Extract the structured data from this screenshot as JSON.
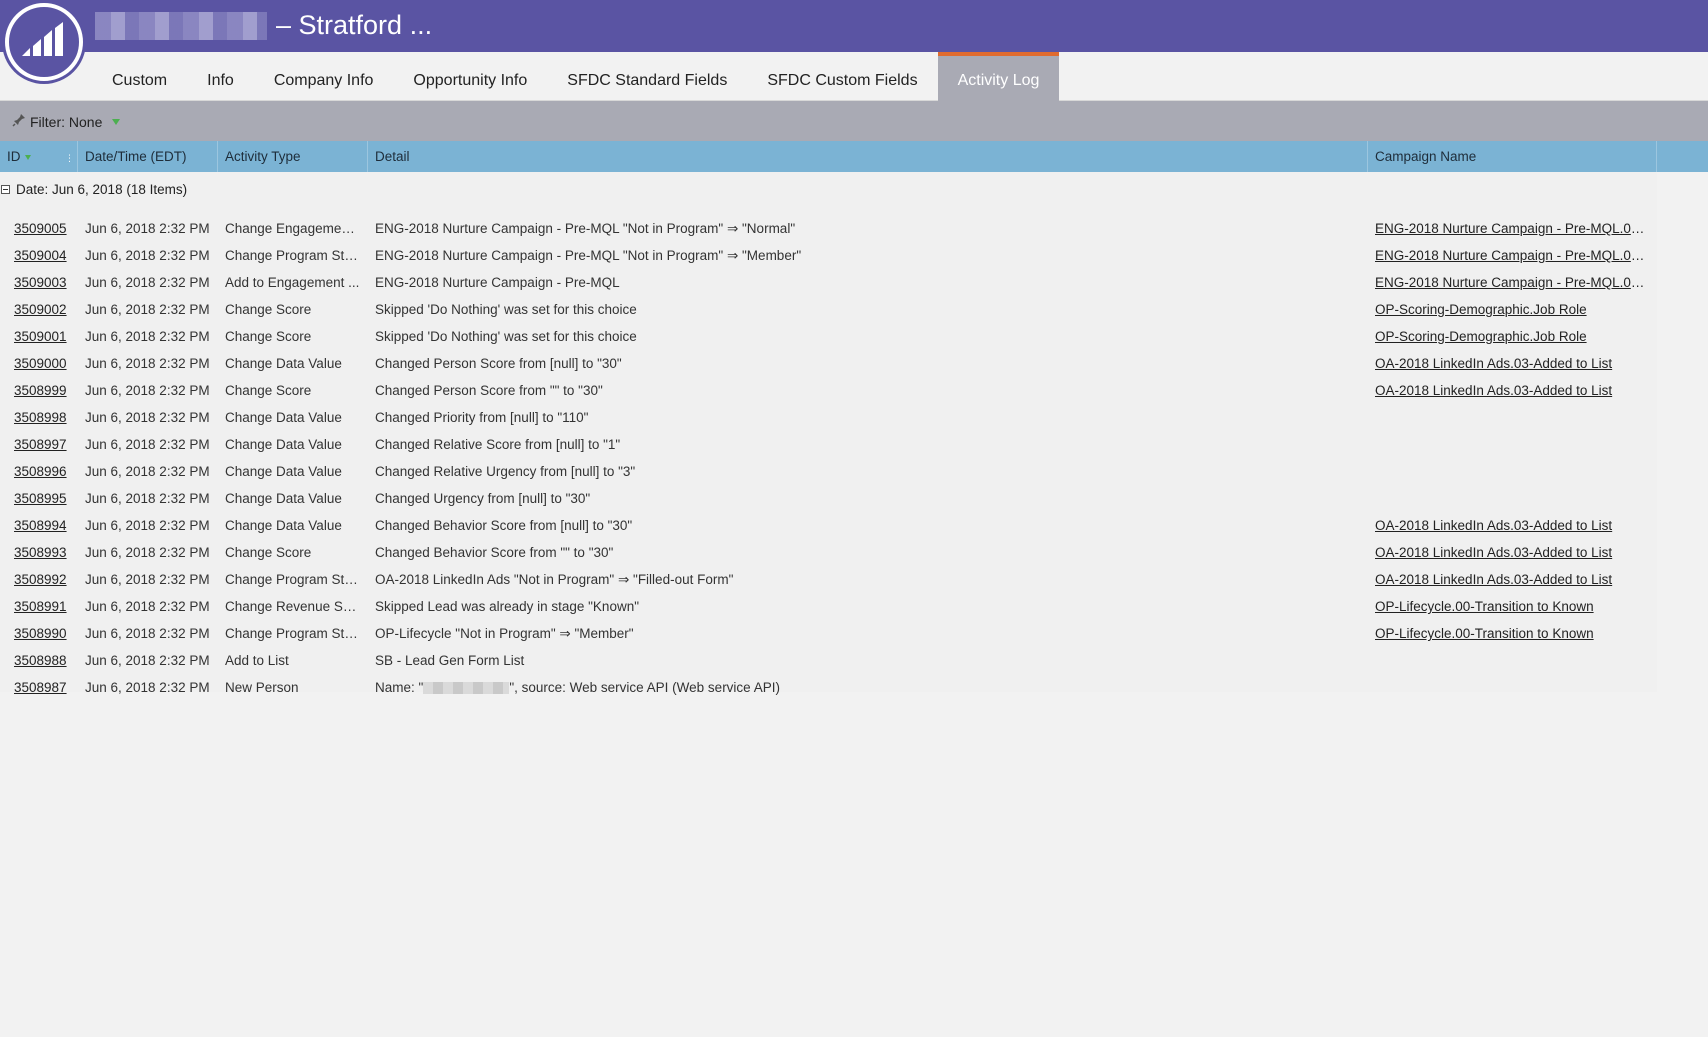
{
  "header": {
    "title_suffix": "– Stratford ..."
  },
  "tabs": [
    {
      "label": "Custom",
      "active": false
    },
    {
      "label": "Info",
      "active": false
    },
    {
      "label": "Company Info",
      "active": false
    },
    {
      "label": "Opportunity Info",
      "active": false
    },
    {
      "label": "SFDC Standard Fields",
      "active": false
    },
    {
      "label": "SFDC Custom Fields",
      "active": false
    },
    {
      "label": "Activity Log",
      "active": true
    }
  ],
  "filter": {
    "label": "Filter: None"
  },
  "columns": {
    "id": "ID",
    "datetime": "Date/Time (EDT)",
    "type": "Activity Type",
    "detail": "Detail",
    "campaign": "Campaign Name"
  },
  "group": {
    "label": "Date: Jun 6, 2018 (18 Items)"
  },
  "rows": [
    {
      "id": "3509005",
      "datetime": "Jun 6, 2018 2:32 PM",
      "type": "Change Engagemen...",
      "detail": "ENG-2018 Nurture Campaign - Pre-MQL \"Not in Program\" ⇒ \"Normal\"",
      "campaign": "ENG-2018 Nurture Campaign - Pre-MQL.01-..."
    },
    {
      "id": "3509004",
      "datetime": "Jun 6, 2018 2:32 PM",
      "type": "Change Program Sta...",
      "detail": "ENG-2018 Nurture Campaign - Pre-MQL \"Not in Program\" ⇒ \"Member\"",
      "campaign": "ENG-2018 Nurture Campaign - Pre-MQL.01-..."
    },
    {
      "id": "3509003",
      "datetime": "Jun 6, 2018 2:32 PM",
      "type": "Add to Engagement ...",
      "detail": "ENG-2018 Nurture Campaign - Pre-MQL",
      "campaign": "ENG-2018 Nurture Campaign - Pre-MQL.01-..."
    },
    {
      "id": "3509002",
      "datetime": "Jun 6, 2018 2:32 PM",
      "type": "Change Score",
      "detail": "Skipped 'Do Nothing' was set for this choice",
      "campaign": "OP-Scoring-Demographic.Job Role"
    },
    {
      "id": "3509001",
      "datetime": "Jun 6, 2018 2:32 PM",
      "type": "Change Score",
      "detail": "Skipped 'Do Nothing' was set for this choice",
      "campaign": "OP-Scoring-Demographic.Job Role"
    },
    {
      "id": "3509000",
      "datetime": "Jun 6, 2018 2:32 PM",
      "type": "Change Data Value",
      "detail": "Changed Person Score from [null] to \"30\"",
      "campaign": "OA-2018 LinkedIn Ads.03-Added to List"
    },
    {
      "id": "3508999",
      "datetime": "Jun 6, 2018 2:32 PM",
      "type": "Change Score",
      "detail": "Changed Person Score from \"\" to \"30\"",
      "campaign": "OA-2018 LinkedIn Ads.03-Added to List"
    },
    {
      "id": "3508998",
      "datetime": "Jun 6, 2018 2:32 PM",
      "type": "Change Data Value",
      "detail": "Changed Priority from [null] to \"110\"",
      "campaign": ""
    },
    {
      "id": "3508997",
      "datetime": "Jun 6, 2018 2:32 PM",
      "type": "Change Data Value",
      "detail": "Changed Relative Score from [null] to \"1\"",
      "campaign": ""
    },
    {
      "id": "3508996",
      "datetime": "Jun 6, 2018 2:32 PM",
      "type": "Change Data Value",
      "detail": "Changed Relative Urgency from [null] to \"3\"",
      "campaign": ""
    },
    {
      "id": "3508995",
      "datetime": "Jun 6, 2018 2:32 PM",
      "type": "Change Data Value",
      "detail": "Changed Urgency from [null] to \"30\"",
      "campaign": ""
    },
    {
      "id": "3508994",
      "datetime": "Jun 6, 2018 2:32 PM",
      "type": "Change Data Value",
      "detail": "Changed Behavior Score from [null] to \"30\"",
      "campaign": "OA-2018 LinkedIn Ads.03-Added to List"
    },
    {
      "id": "3508993",
      "datetime": "Jun 6, 2018 2:32 PM",
      "type": "Change Score",
      "detail": "Changed Behavior Score from \"\" to \"30\"",
      "campaign": "OA-2018 LinkedIn Ads.03-Added to List"
    },
    {
      "id": "3508992",
      "datetime": "Jun 6, 2018 2:32 PM",
      "type": "Change Program Sta...",
      "detail": "OA-2018 LinkedIn Ads \"Not in Program\" ⇒ \"Filled-out Form\"",
      "campaign": "OA-2018 LinkedIn Ads.03-Added to List"
    },
    {
      "id": "3508991",
      "datetime": "Jun 6, 2018 2:32 PM",
      "type": "Change Revenue Sta...",
      "detail": "Skipped Lead was already in stage \"Known\"",
      "campaign": "OP-Lifecycle.00-Transition to Known"
    },
    {
      "id": "3508990",
      "datetime": "Jun 6, 2018 2:32 PM",
      "type": "Change Program Sta...",
      "detail": "OP-Lifecycle \"Not in Program\" ⇒ \"Member\"",
      "campaign": "OP-Lifecycle.00-Transition to Known"
    },
    {
      "id": "3508988",
      "datetime": "Jun 6, 2018 2:32 PM",
      "type": "Add to List",
      "detail": "SB - Lead Gen Form List",
      "campaign": ""
    },
    {
      "id": "3508987",
      "datetime": "Jun 6, 2018 2:32 PM",
      "type": "New Person",
      "detail_prefix": "Name: \"",
      "detail_suffix": "\", source: Web service API (Web service API)",
      "campaign": ""
    }
  ]
}
